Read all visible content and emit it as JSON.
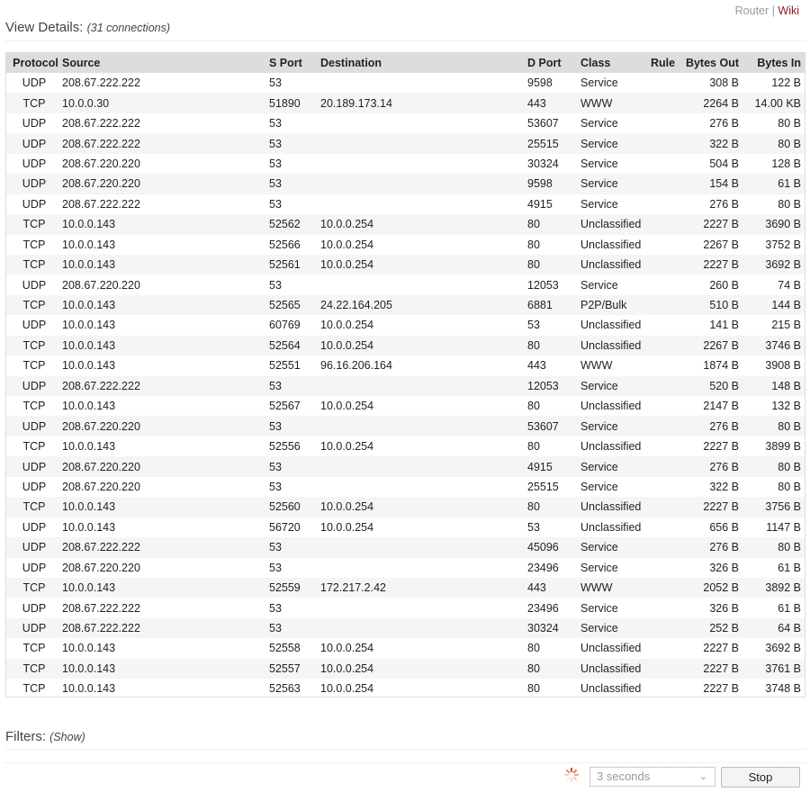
{
  "toplinks": {
    "router": "Router",
    "separator": "|",
    "wiki": "Wiki"
  },
  "header": {
    "title": "View Details:",
    "subtitle": "(31 connections)"
  },
  "table": {
    "columns": [
      "Protocol",
      "Source",
      "S Port",
      "Destination",
      "D Port",
      "Class",
      "Rule",
      "Bytes Out",
      "Bytes In"
    ],
    "rows": [
      [
        "UDP",
        "208.67.222.222",
        "53",
        "",
        "9598",
        "Service",
        "",
        "308 B",
        "122 B"
      ],
      [
        "TCP",
        "10.0.0.30",
        "51890",
        "20.189.173.14",
        "443",
        "WWW",
        "",
        "2264 B",
        "14.00 KB"
      ],
      [
        "UDP",
        "208.67.222.222",
        "53",
        "",
        "53607",
        "Service",
        "",
        "276 B",
        "80 B"
      ],
      [
        "UDP",
        "208.67.222.222",
        "53",
        "",
        "25515",
        "Service",
        "",
        "322 B",
        "80 B"
      ],
      [
        "UDP",
        "208.67.220.220",
        "53",
        "",
        "30324",
        "Service",
        "",
        "504 B",
        "128 B"
      ],
      [
        "UDP",
        "208.67.220.220",
        "53",
        "",
        "9598",
        "Service",
        "",
        "154 B",
        "61 B"
      ],
      [
        "UDP",
        "208.67.222.222",
        "53",
        "",
        "4915",
        "Service",
        "",
        "276 B",
        "80 B"
      ],
      [
        "TCP",
        "10.0.0.143",
        "52562",
        "10.0.0.254",
        "80",
        "Unclassified",
        "",
        "2227 B",
        "3690 B"
      ],
      [
        "TCP",
        "10.0.0.143",
        "52566",
        "10.0.0.254",
        "80",
        "Unclassified",
        "",
        "2267 B",
        "3752 B"
      ],
      [
        "TCP",
        "10.0.0.143",
        "52561",
        "10.0.0.254",
        "80",
        "Unclassified",
        "",
        "2227 B",
        "3692 B"
      ],
      [
        "UDP",
        "208.67.220.220",
        "53",
        "",
        "12053",
        "Service",
        "",
        "260 B",
        "74 B"
      ],
      [
        "TCP",
        "10.0.0.143",
        "52565",
        "24.22.164.205",
        "6881",
        "P2P/Bulk",
        "",
        "510 B",
        "144 B"
      ],
      [
        "UDP",
        "10.0.0.143",
        "60769",
        "10.0.0.254",
        "53",
        "Unclassified",
        "",
        "141 B",
        "215 B"
      ],
      [
        "TCP",
        "10.0.0.143",
        "52564",
        "10.0.0.254",
        "80",
        "Unclassified",
        "",
        "2267 B",
        "3746 B"
      ],
      [
        "TCP",
        "10.0.0.143",
        "52551",
        "96.16.206.164",
        "443",
        "WWW",
        "",
        "1874 B",
        "3908 B"
      ],
      [
        "UDP",
        "208.67.222.222",
        "53",
        "",
        "12053",
        "Service",
        "",
        "520 B",
        "148 B"
      ],
      [
        "TCP",
        "10.0.0.143",
        "52567",
        "10.0.0.254",
        "80",
        "Unclassified",
        "",
        "2147 B",
        "132 B"
      ],
      [
        "UDP",
        "208.67.220.220",
        "53",
        "",
        "53607",
        "Service",
        "",
        "276 B",
        "80 B"
      ],
      [
        "TCP",
        "10.0.0.143",
        "52556",
        "10.0.0.254",
        "80",
        "Unclassified",
        "",
        "2227 B",
        "3899 B"
      ],
      [
        "UDP",
        "208.67.220.220",
        "53",
        "",
        "4915",
        "Service",
        "",
        "276 B",
        "80 B"
      ],
      [
        "UDP",
        "208.67.220.220",
        "53",
        "",
        "25515",
        "Service",
        "",
        "322 B",
        "80 B"
      ],
      [
        "TCP",
        "10.0.0.143",
        "52560",
        "10.0.0.254",
        "80",
        "Unclassified",
        "",
        "2227 B",
        "3756 B"
      ],
      [
        "UDP",
        "10.0.0.143",
        "56720",
        "10.0.0.254",
        "53",
        "Unclassified",
        "",
        "656 B",
        "1147 B"
      ],
      [
        "UDP",
        "208.67.222.222",
        "53",
        "",
        "45096",
        "Service",
        "",
        "276 B",
        "80 B"
      ],
      [
        "UDP",
        "208.67.220.220",
        "53",
        "",
        "23496",
        "Service",
        "",
        "326 B",
        "61 B"
      ],
      [
        "TCP",
        "10.0.0.143",
        "52559",
        "172.217.2.42",
        "443",
        "WWW",
        "",
        "2052 B",
        "3892 B"
      ],
      [
        "UDP",
        "208.67.222.222",
        "53",
        "",
        "23496",
        "Service",
        "",
        "326 B",
        "61 B"
      ],
      [
        "UDP",
        "208.67.222.222",
        "53",
        "",
        "30324",
        "Service",
        "",
        "252 B",
        "64 B"
      ],
      [
        "TCP",
        "10.0.0.143",
        "52558",
        "10.0.0.254",
        "80",
        "Unclassified",
        "",
        "2227 B",
        "3692 B"
      ],
      [
        "TCP",
        "10.0.0.143",
        "52557",
        "10.0.0.254",
        "80",
        "Unclassified",
        "",
        "2227 B",
        "3761 B"
      ],
      [
        "TCP",
        "10.0.0.143",
        "52563",
        "10.0.0.254",
        "80",
        "Unclassified",
        "",
        "2227 B",
        "3748 B"
      ]
    ]
  },
  "filters": {
    "label": "Filters:",
    "toggle": "(Show)"
  },
  "controls": {
    "refresh_select": "3 seconds",
    "stop_label": "Stop",
    "spinner_icon": "loading-spinner-icon",
    "chevron_icon": "chevron-down-icon"
  },
  "colors": {
    "link_accent": "#8a1c1c",
    "header_bg": "#dddddd",
    "row_alt_bg": "#f5f5f5"
  }
}
